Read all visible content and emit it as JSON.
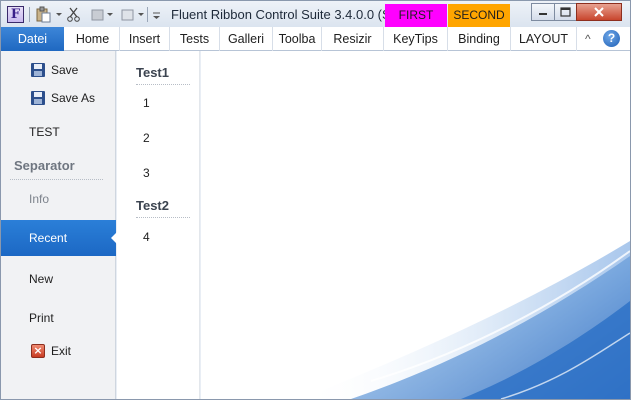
{
  "app": {
    "icon_letter": "F",
    "title": "Fluent Ribbon Control Suite 3.4.0.0 (SR...",
    "contextual_groups": [
      "FIRST",
      "SECOND"
    ]
  },
  "colors": {
    "file_tab": "#2a78d2",
    "first_group": "#ff00ff",
    "second_group": "#ffa500",
    "selected_item": "#2274d0"
  },
  "ribbon": {
    "file_tab": "Datei",
    "tabs": [
      "Home",
      "Insert",
      "Tests",
      "Galleri",
      "Toolba",
      "Resizir",
      "KeyTips",
      "Binding",
      "LAYOUT"
    ]
  },
  "backstage": {
    "items": {
      "save": "Save",
      "save_as": "Save As",
      "test": "TEST",
      "separator": "Separator",
      "info": "Info",
      "recent": "Recent",
      "new": "New",
      "print": "Print",
      "exit": "Exit"
    }
  },
  "content": {
    "groups": [
      {
        "title": "Test1",
        "items": [
          "1",
          "2",
          "3"
        ]
      },
      {
        "title": "Test2",
        "items": [
          "4"
        ]
      }
    ]
  }
}
